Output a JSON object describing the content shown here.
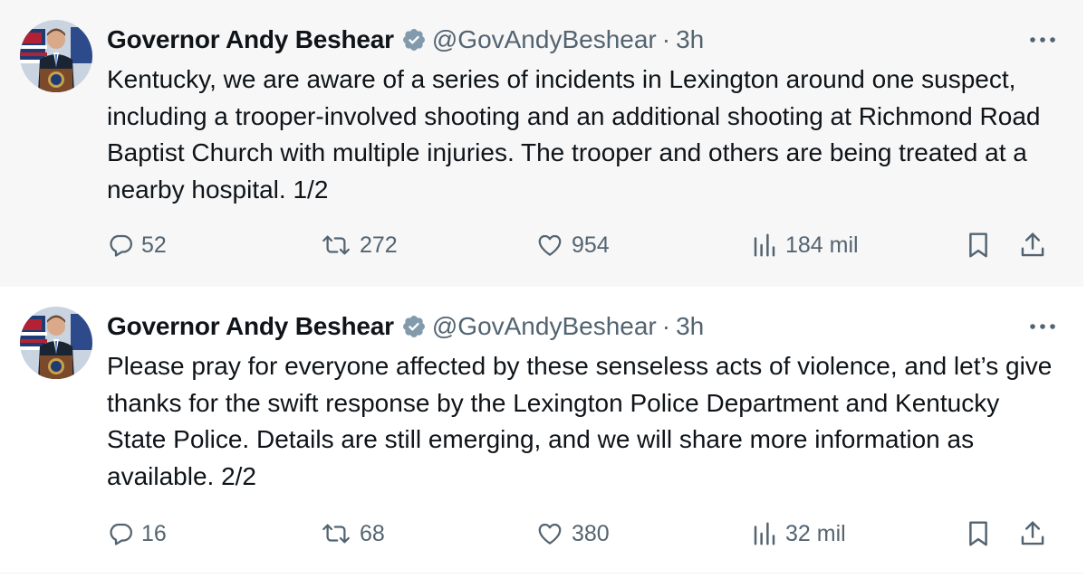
{
  "tweets": [
    {
      "author_name": "Governor Andy Beshear",
      "handle": "@GovAndyBeshear",
      "separator": "·",
      "time": "3h",
      "text": "Kentucky, we are aware of a series of incidents in Lexington around one suspect, including a trooper-involved shooting and an additional shooting at Richmond Road Baptist Church with multiple injuries. The trooper and others are being treated at a nearby hospital. 1/2",
      "replies": "52",
      "retweets": "272",
      "likes": "954",
      "views": "184 mil"
    },
    {
      "author_name": "Governor Andy Beshear",
      "handle": "@GovAndyBeshear",
      "separator": "·",
      "time": "3h",
      "text": "Please pray for everyone affected by these senseless acts of violence, and let’s give thanks for the swift response by the Lexington Police Department and Kentucky State Police. Details are still emerging, and we will share more information as available. 2/2",
      "replies": "16",
      "retweets": "68",
      "likes": "380",
      "views": "32 mil"
    }
  ],
  "colors": {
    "text": "#0f1419",
    "secondary": "#536471",
    "verified_badge": "#829aab",
    "thread_line": "#cfd9de",
    "highlight_background": "#f7f7f7"
  },
  "icons": [
    "verified-badge-icon",
    "more-icon",
    "reply-icon",
    "retweet-icon",
    "like-icon",
    "views-icon",
    "bookmark-icon",
    "share-icon"
  ]
}
